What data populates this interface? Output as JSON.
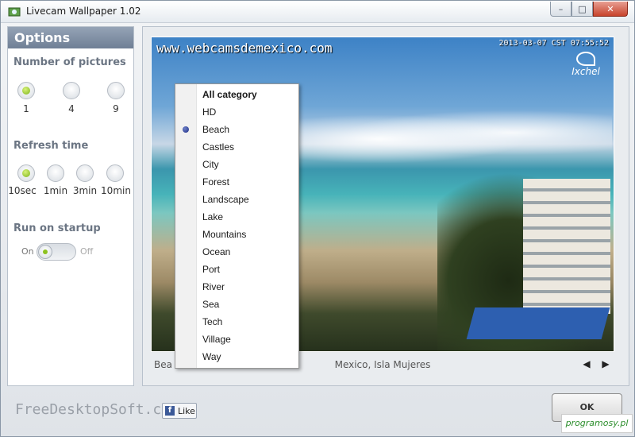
{
  "window": {
    "title": "Livecam Wallpaper 1.02",
    "minimize": "–",
    "maximize": "□",
    "close": "✕"
  },
  "sidebar": {
    "title": "Options",
    "pictures": {
      "title": "Number of pictures",
      "options": [
        "1",
        "4",
        "9"
      ],
      "selected": "1"
    },
    "refresh": {
      "title": "Refresh time",
      "options": [
        "10sec",
        "1min",
        "3min",
        "10min"
      ],
      "selected": "10sec"
    },
    "startup": {
      "title": "Run on startup",
      "on_label": "On",
      "off_label": "Off",
      "state": "on"
    }
  },
  "preview": {
    "site_url": "www.webcamsdemexico.com",
    "timestamp": "2013-03-07 CST 07:55:52",
    "logo_text": "Ixchel",
    "category_left": "Bea",
    "caption": "Mexico, Isla Mujeres",
    "prev": "◀",
    "next": "▶"
  },
  "category_menu": {
    "items": [
      "All category",
      "HD",
      "Beach",
      "Castles",
      "City",
      "Forest",
      "Landscape",
      "Lake",
      "Mountains",
      "Ocean",
      "Port",
      "River",
      "Sea",
      "Tech",
      "Village",
      "Way"
    ],
    "selected": "Beach"
  },
  "footer": {
    "brand": "FreeDesktopSoft.com",
    "like_icon": "f",
    "like_label": "Like",
    "ok_label": "OK",
    "watermark": "programosy.pl"
  }
}
